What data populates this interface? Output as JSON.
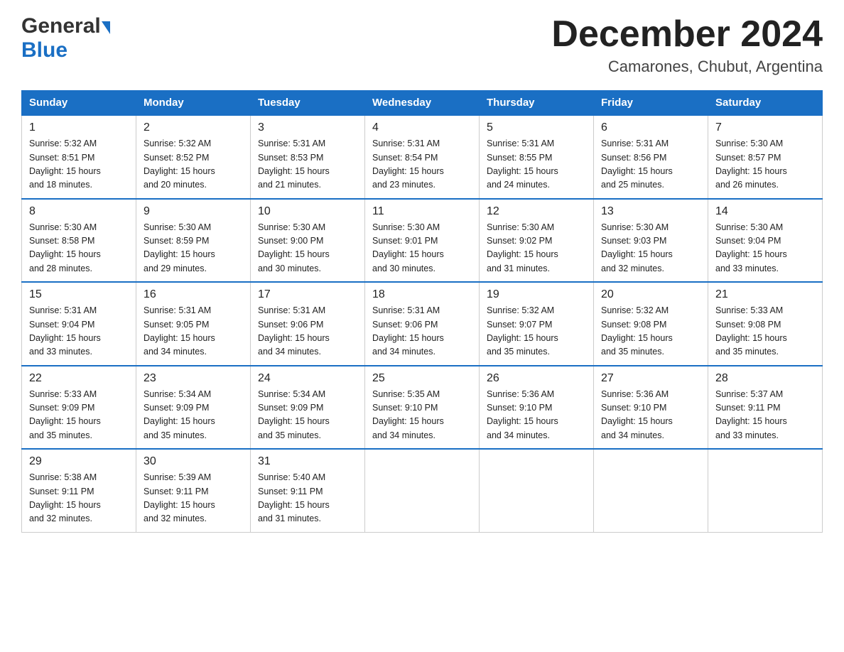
{
  "header": {
    "logo_general": "General",
    "logo_blue": "Blue",
    "month_title": "December 2024",
    "location": "Camarones, Chubut, Argentina"
  },
  "weekdays": [
    "Sunday",
    "Monday",
    "Tuesday",
    "Wednesday",
    "Thursday",
    "Friday",
    "Saturday"
  ],
  "weeks": [
    [
      {
        "day": "1",
        "info": "Sunrise: 5:32 AM\nSunset: 8:51 PM\nDaylight: 15 hours\nand 18 minutes."
      },
      {
        "day": "2",
        "info": "Sunrise: 5:32 AM\nSunset: 8:52 PM\nDaylight: 15 hours\nand 20 minutes."
      },
      {
        "day": "3",
        "info": "Sunrise: 5:31 AM\nSunset: 8:53 PM\nDaylight: 15 hours\nand 21 minutes."
      },
      {
        "day": "4",
        "info": "Sunrise: 5:31 AM\nSunset: 8:54 PM\nDaylight: 15 hours\nand 23 minutes."
      },
      {
        "day": "5",
        "info": "Sunrise: 5:31 AM\nSunset: 8:55 PM\nDaylight: 15 hours\nand 24 minutes."
      },
      {
        "day": "6",
        "info": "Sunrise: 5:31 AM\nSunset: 8:56 PM\nDaylight: 15 hours\nand 25 minutes."
      },
      {
        "day": "7",
        "info": "Sunrise: 5:30 AM\nSunset: 8:57 PM\nDaylight: 15 hours\nand 26 minutes."
      }
    ],
    [
      {
        "day": "8",
        "info": "Sunrise: 5:30 AM\nSunset: 8:58 PM\nDaylight: 15 hours\nand 28 minutes."
      },
      {
        "day": "9",
        "info": "Sunrise: 5:30 AM\nSunset: 8:59 PM\nDaylight: 15 hours\nand 29 minutes."
      },
      {
        "day": "10",
        "info": "Sunrise: 5:30 AM\nSunset: 9:00 PM\nDaylight: 15 hours\nand 30 minutes."
      },
      {
        "day": "11",
        "info": "Sunrise: 5:30 AM\nSunset: 9:01 PM\nDaylight: 15 hours\nand 30 minutes."
      },
      {
        "day": "12",
        "info": "Sunrise: 5:30 AM\nSunset: 9:02 PM\nDaylight: 15 hours\nand 31 minutes."
      },
      {
        "day": "13",
        "info": "Sunrise: 5:30 AM\nSunset: 9:03 PM\nDaylight: 15 hours\nand 32 minutes."
      },
      {
        "day": "14",
        "info": "Sunrise: 5:30 AM\nSunset: 9:04 PM\nDaylight: 15 hours\nand 33 minutes."
      }
    ],
    [
      {
        "day": "15",
        "info": "Sunrise: 5:31 AM\nSunset: 9:04 PM\nDaylight: 15 hours\nand 33 minutes."
      },
      {
        "day": "16",
        "info": "Sunrise: 5:31 AM\nSunset: 9:05 PM\nDaylight: 15 hours\nand 34 minutes."
      },
      {
        "day": "17",
        "info": "Sunrise: 5:31 AM\nSunset: 9:06 PM\nDaylight: 15 hours\nand 34 minutes."
      },
      {
        "day": "18",
        "info": "Sunrise: 5:31 AM\nSunset: 9:06 PM\nDaylight: 15 hours\nand 34 minutes."
      },
      {
        "day": "19",
        "info": "Sunrise: 5:32 AM\nSunset: 9:07 PM\nDaylight: 15 hours\nand 35 minutes."
      },
      {
        "day": "20",
        "info": "Sunrise: 5:32 AM\nSunset: 9:08 PM\nDaylight: 15 hours\nand 35 minutes."
      },
      {
        "day": "21",
        "info": "Sunrise: 5:33 AM\nSunset: 9:08 PM\nDaylight: 15 hours\nand 35 minutes."
      }
    ],
    [
      {
        "day": "22",
        "info": "Sunrise: 5:33 AM\nSunset: 9:09 PM\nDaylight: 15 hours\nand 35 minutes."
      },
      {
        "day": "23",
        "info": "Sunrise: 5:34 AM\nSunset: 9:09 PM\nDaylight: 15 hours\nand 35 minutes."
      },
      {
        "day": "24",
        "info": "Sunrise: 5:34 AM\nSunset: 9:09 PM\nDaylight: 15 hours\nand 35 minutes."
      },
      {
        "day": "25",
        "info": "Sunrise: 5:35 AM\nSunset: 9:10 PM\nDaylight: 15 hours\nand 34 minutes."
      },
      {
        "day": "26",
        "info": "Sunrise: 5:36 AM\nSunset: 9:10 PM\nDaylight: 15 hours\nand 34 minutes."
      },
      {
        "day": "27",
        "info": "Sunrise: 5:36 AM\nSunset: 9:10 PM\nDaylight: 15 hours\nand 34 minutes."
      },
      {
        "day": "28",
        "info": "Sunrise: 5:37 AM\nSunset: 9:11 PM\nDaylight: 15 hours\nand 33 minutes."
      }
    ],
    [
      {
        "day": "29",
        "info": "Sunrise: 5:38 AM\nSunset: 9:11 PM\nDaylight: 15 hours\nand 32 minutes."
      },
      {
        "day": "30",
        "info": "Sunrise: 5:39 AM\nSunset: 9:11 PM\nDaylight: 15 hours\nand 32 minutes."
      },
      {
        "day": "31",
        "info": "Sunrise: 5:40 AM\nSunset: 9:11 PM\nDaylight: 15 hours\nand 31 minutes."
      },
      {
        "day": "",
        "info": ""
      },
      {
        "day": "",
        "info": ""
      },
      {
        "day": "",
        "info": ""
      },
      {
        "day": "",
        "info": ""
      }
    ]
  ]
}
